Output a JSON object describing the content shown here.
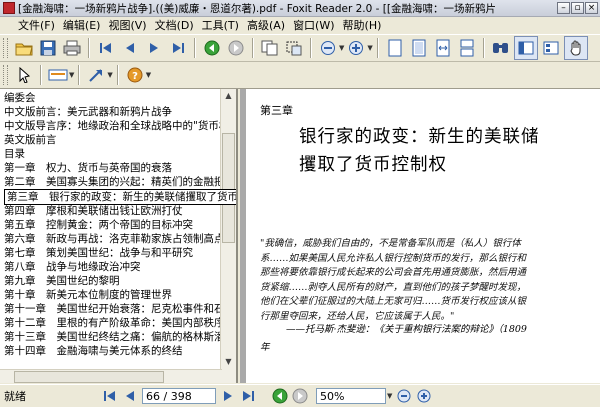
{
  "window": {
    "title": "[金融海啸：一场新鸦片战争].((美)威廉・恩道尔著).pdf - Foxit Reader 2.0 - [[金融海啸：一场新鸦片"
  },
  "menu": {
    "items": [
      "文件(F)",
      "编辑(E)",
      "视图(V)",
      "文档(D)",
      "工具(T)",
      "高级(A)",
      "窗口(W)",
      "帮助(H)"
    ]
  },
  "bookmarks": {
    "items": [
      "编委会",
      "中文版前言：美元武器和新鸦片战争",
      "中文版导言序：地缘政治和全球战略中的\"货币权",
      "英文版前言",
      "目录",
      "第一章　权力、货币与英帝国的衰落",
      "第二章　美国寡头集团的兴起：精英们的金融把持",
      "第三章　银行家的政变：新生的美联储攫取了货币控制权",
      "第四章　摩根和美联储出钱让欧洲打仗",
      "第五章　控制黄金：两个帝国的目标冲突",
      "第六章　新政与再战：洛克菲勒家族占领制高点",
      "第七章　策划美国世纪：战争与和平研究",
      "第八章　战争与地缘政治冲突",
      "第九章　美国世纪的黎明",
      "第十章　新美元本位制度的管理世界",
      "第十一章　美国世纪开始衰落：尼克松事件和石油",
      "第十二章　里根的有产阶级革命：美国内部秩序",
      "第十三章　美国世纪终结之痛：偏航的格林斯潘金",
      "第十四章　金融海啸与美元体系的终结"
    ],
    "selected_index": 7
  },
  "document": {
    "chapter_label": "第三章",
    "heading_line1": "银行家的政变：新生的美联储",
    "heading_line2": "攫取了货币控制权",
    "quote_lines": [
      "\"我确信，威胁我们自由的，不是常备军队而是（私人）银行体",
      "系……如果美国人民允许私人银行控制货币的发行，那么银行和",
      "那些将要依靠银行成长起来的公司会首先用通货膨胀，然后用通",
      "货紧缩……剥夺人民所有的财产，直到他们的孩子梦醒时发现，",
      "他们在父辈们征服过的大陆上无家可归……货币发行权应该从银",
      "行那里夺回来，还给人民，它应该属于人民。\""
    ],
    "attribution": "——托马斯·杰斐逊：《关于重构银行法案的辩论》（1809",
    "attribution_end": "年"
  },
  "statusbar": {
    "status": "就绪",
    "page_display": "66 / 398",
    "zoom": "50%"
  }
}
